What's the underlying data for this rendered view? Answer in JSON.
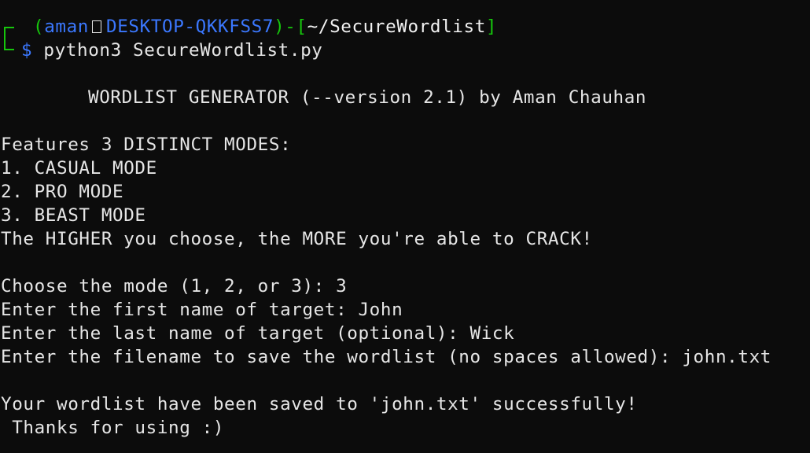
{
  "prompt": {
    "user": "aman",
    "host": "DESKTOP-QKKFSS7",
    "path": "~/SecureWordlist",
    "symbol": "$",
    "command": "python3 SecureWordlist.py"
  },
  "output": {
    "title": "WORDLIST GENERATOR (--version 2.1) by Aman Chauhan",
    "features_heading": "Features 3 DISTINCT MODES:",
    "mode_1": "1. CASUAL MODE",
    "mode_2": "2. PRO MODE",
    "mode_3": "3. BEAST MODE",
    "tagline": "The HIGHER you choose, the MORE you're able to CRACK!",
    "prompt_mode": "Choose the mode (1, 2, or 3): 3",
    "prompt_first": "Enter the first name of target: John",
    "prompt_last": "Enter the last name of target (optional): Wick",
    "prompt_file": "Enter the filename to save the wordlist (no spaces allowed): john.txt",
    "saved": "Your wordlist have been saved to 'john.txt' successfully!",
    "thanks": " Thanks for using :)"
  },
  "colors": {
    "background": "#0c0c0c",
    "text": "#e6e6e6",
    "prompt_green": "#16c60c",
    "prompt_blue": "#3b78ff"
  }
}
